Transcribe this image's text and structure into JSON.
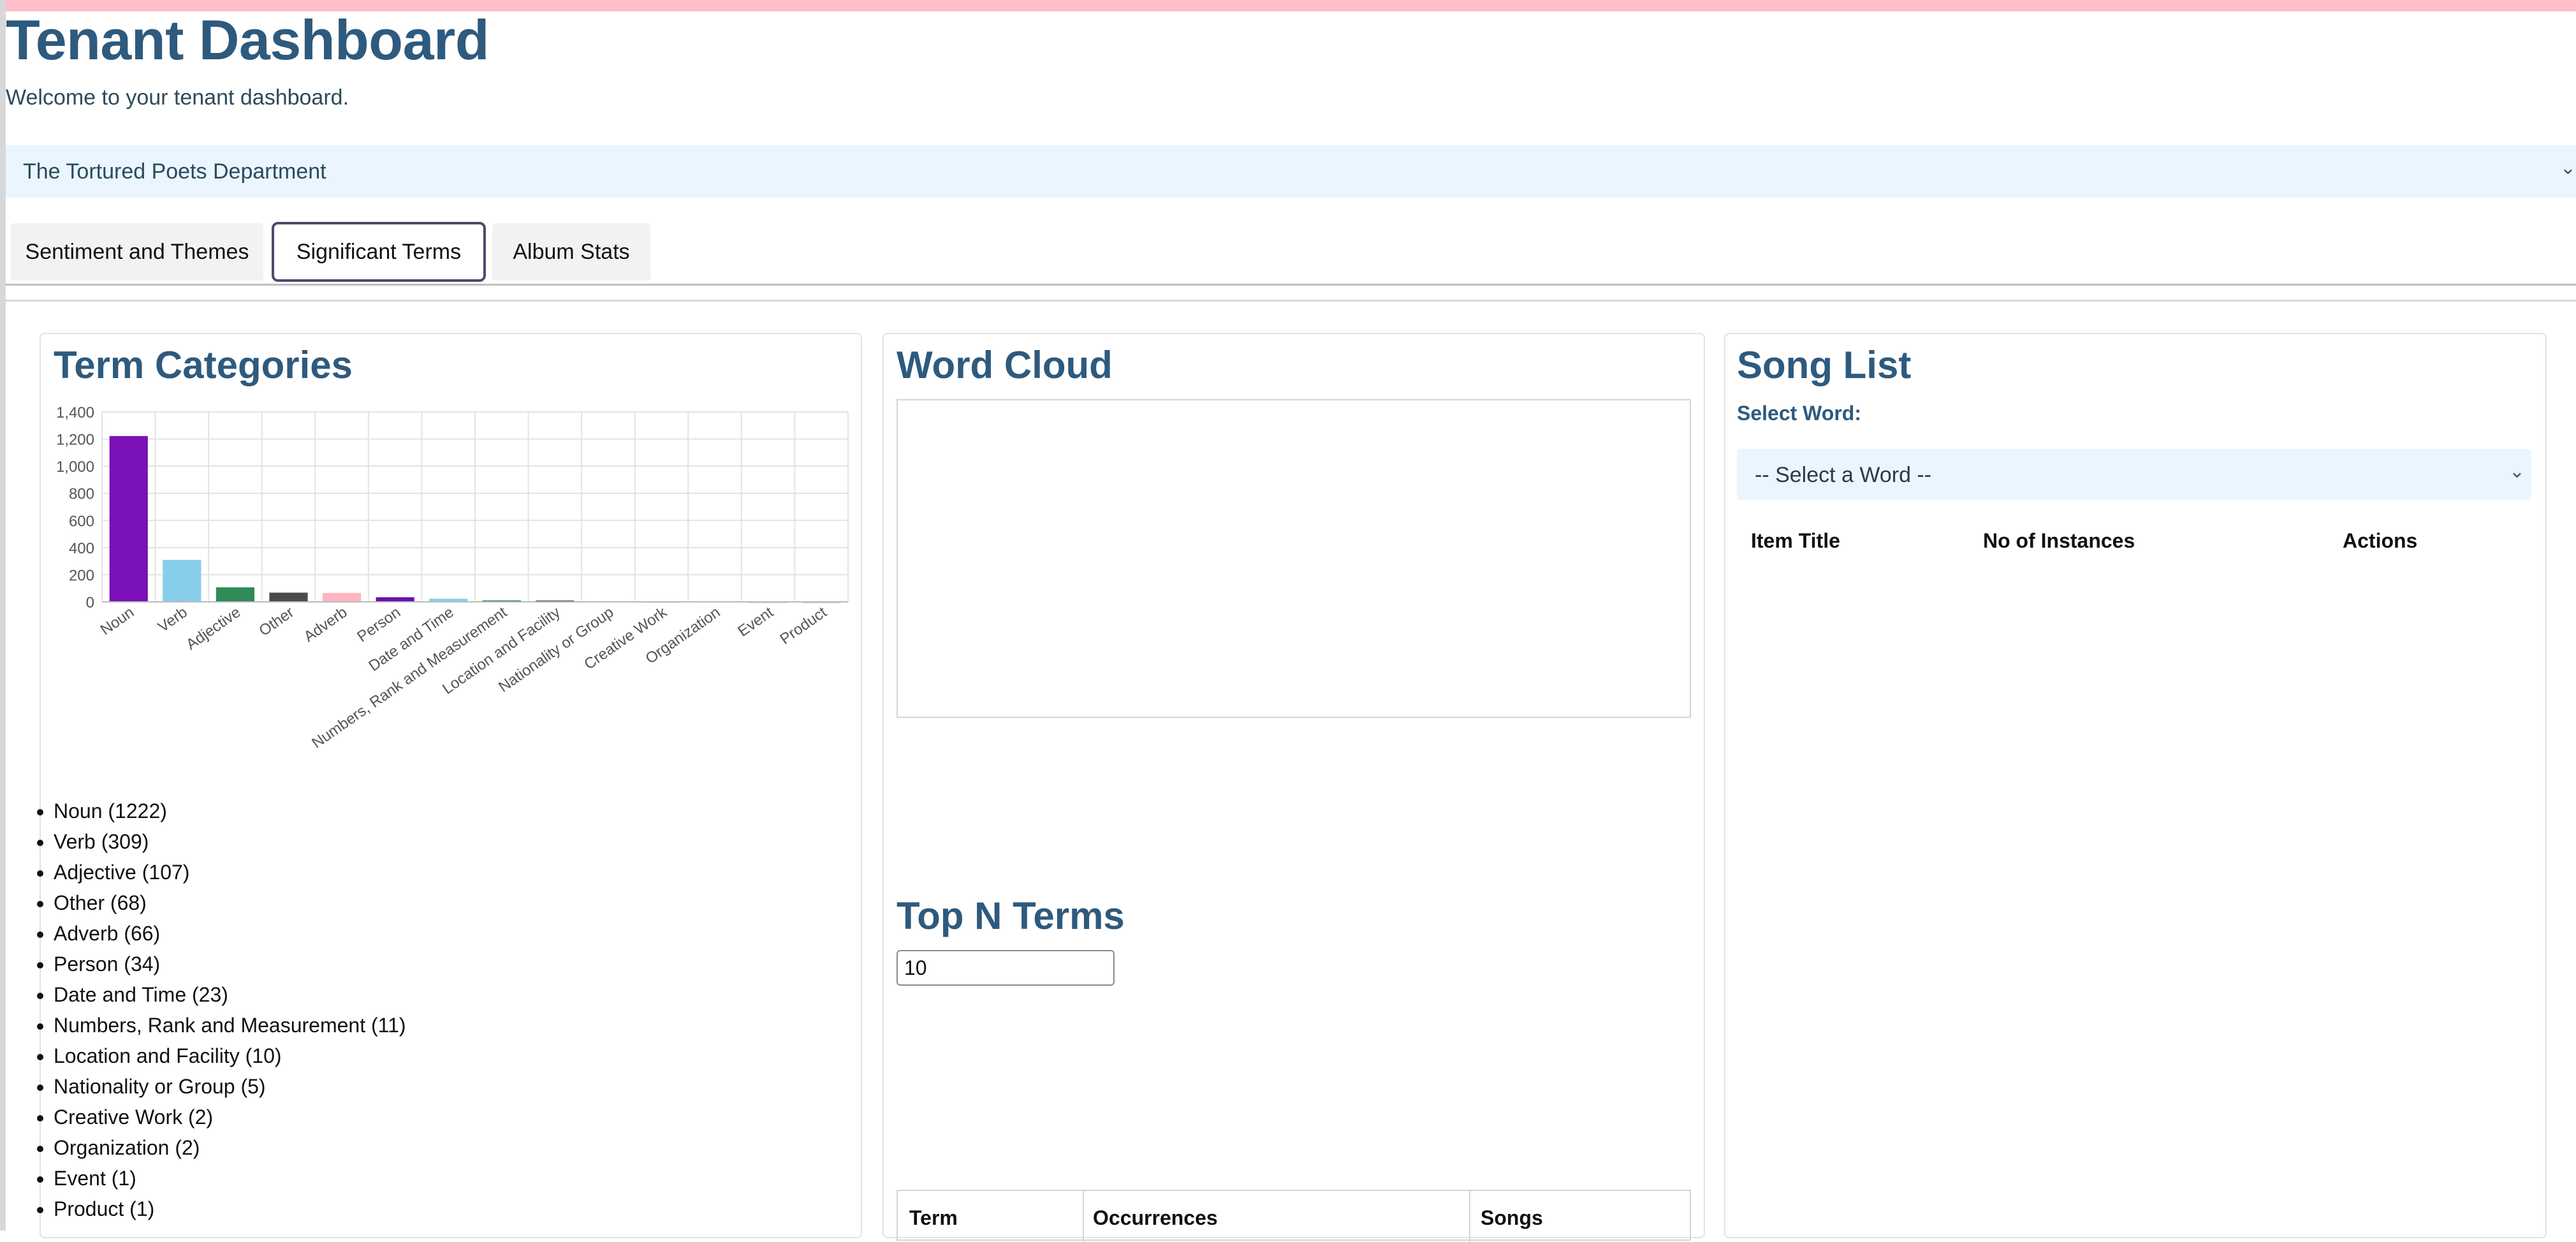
{
  "header": {
    "title": "Tenant Dashboard",
    "welcome": "Welcome to your tenant dashboard."
  },
  "album_select": {
    "value": "The Tortured Poets Department",
    "chevron_icon": "chevron-down-icon"
  },
  "tabs": [
    {
      "label": "Sentiment and Themes",
      "active": false
    },
    {
      "label": "Significant Terms",
      "active": true
    },
    {
      "label": "Album Stats",
      "active": false
    }
  ],
  "term_categories": {
    "title": "Term Categories",
    "items": [
      "Noun (1222)",
      "Verb (309)",
      "Adjective (107)",
      "Other (68)",
      "Adverb (66)",
      "Person (34)",
      "Date and Time (23)",
      "Numbers, Rank and Measurement (11)",
      "Location and Facility (10)",
      "Nationality or Group (5)",
      "Creative Work (2)",
      "Organization (2)",
      "Event (1)",
      "Product (1)"
    ]
  },
  "chart_data": {
    "type": "bar",
    "categories": [
      "Noun",
      "Verb",
      "Adjective",
      "Other",
      "Adverb",
      "Person",
      "Date and Time",
      "Numbers, Rank and Measurement",
      "Location and Facility",
      "Nationality or Group",
      "Creative Work",
      "Organization",
      "Event",
      "Product"
    ],
    "values": [
      1222,
      309,
      107,
      68,
      66,
      34,
      23,
      11,
      10,
      5,
      2,
      2,
      1,
      1
    ],
    "colors": [
      "#7a12b8",
      "#87ceeb",
      "#2e8b57",
      "#4a4a4a",
      "#ffb6c1",
      "#6a0dad",
      "#87ceeb",
      "#2e8b57",
      "#4a4a4a",
      "#ffb6c1",
      "#6a0dad",
      "#87ceeb",
      "#2e8b57",
      "#4a4a4a"
    ],
    "yticks": [
      "0",
      "200",
      "400",
      "600",
      "800",
      "1,000",
      "1,200",
      "1,400"
    ],
    "ylim": [
      0,
      1400
    ],
    "grid": true,
    "legend": false,
    "title": "",
    "xlabel": "",
    "ylabel": ""
  },
  "word_cloud": {
    "title": "Word Cloud"
  },
  "top_n": {
    "title": "Top N Terms",
    "value": "10",
    "columns": [
      "Term",
      "Occurrences",
      "Songs"
    ]
  },
  "song_list": {
    "title": "Song List",
    "select_label": "Select Word:",
    "select_value": "-- Select a Word --",
    "columns": [
      "Item Title",
      "No of Instances",
      "Actions"
    ]
  }
}
